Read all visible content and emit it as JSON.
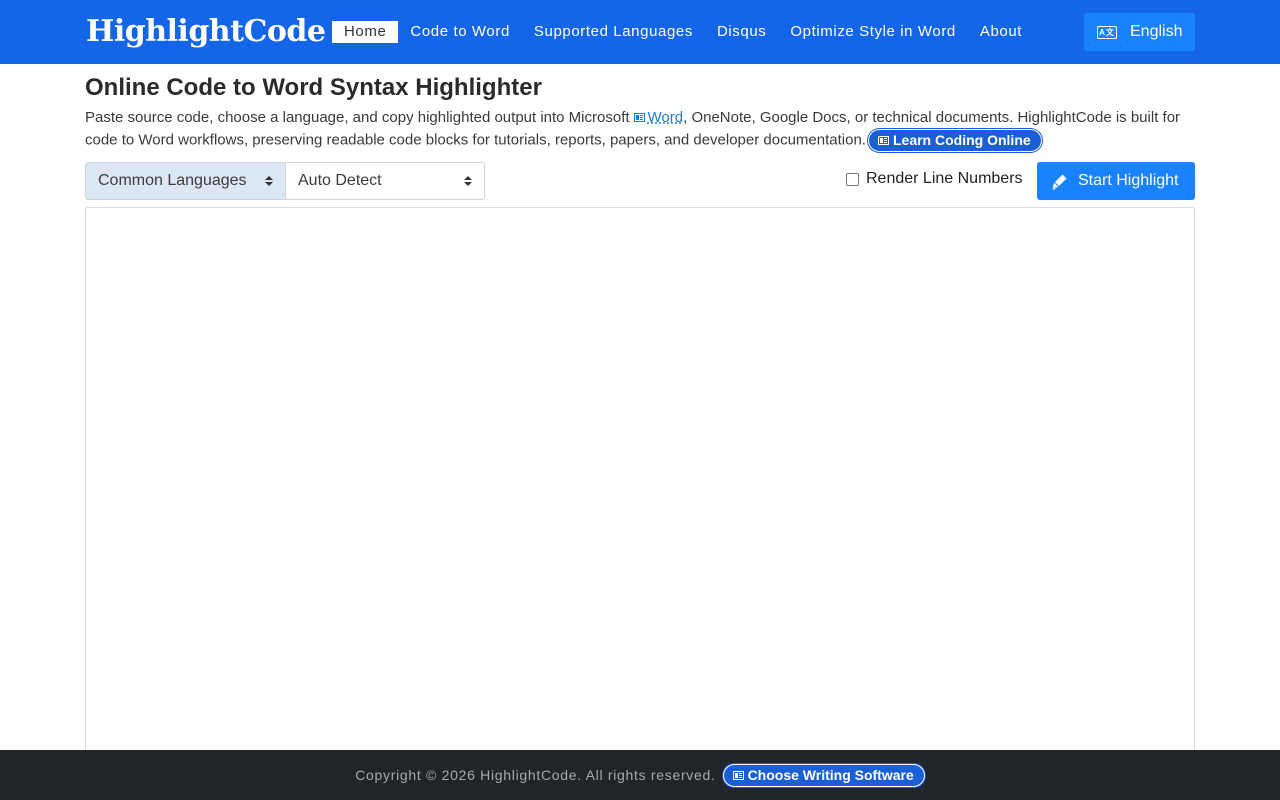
{
  "navbar": {
    "brand": "HighlightCode",
    "items": [
      {
        "label": "Home",
        "active": true
      },
      {
        "label": "Code to Word"
      },
      {
        "label": "Supported Languages"
      },
      {
        "label": "Disqus"
      },
      {
        "label": "Optimize Style in Word"
      },
      {
        "label": "About"
      }
    ],
    "language_label": "English",
    "language_icon": "translate-icon",
    "color": "#1565e8"
  },
  "main": {
    "title": "Online Code to Word Syntax Highlighter",
    "intro_before_link": "Paste source code, choose a language, and copy highlighted output into Microsoft",
    "word_link": "Word",
    "intro_after_link": ", OneNote, Google Docs, or technical documents. HighlightCode is built for code to Word workflows, preserving readable code blocks for tutorials, reports, papers, and developer documentation.",
    "learn_button": "Learn Coding Online"
  },
  "controls": {
    "language_group": "Common Languages",
    "language": "Auto Detect",
    "line_numbers_label": "Render Line Numbers",
    "line_numbers_checked": false,
    "start_button": "Start Highlight",
    "accent": "#1a82ff"
  },
  "editor": {
    "value": ""
  },
  "footer": {
    "copyright": "Copyright © 2026 HighlightCode. All rights reserved.",
    "software_button": "Choose Writing Software"
  }
}
